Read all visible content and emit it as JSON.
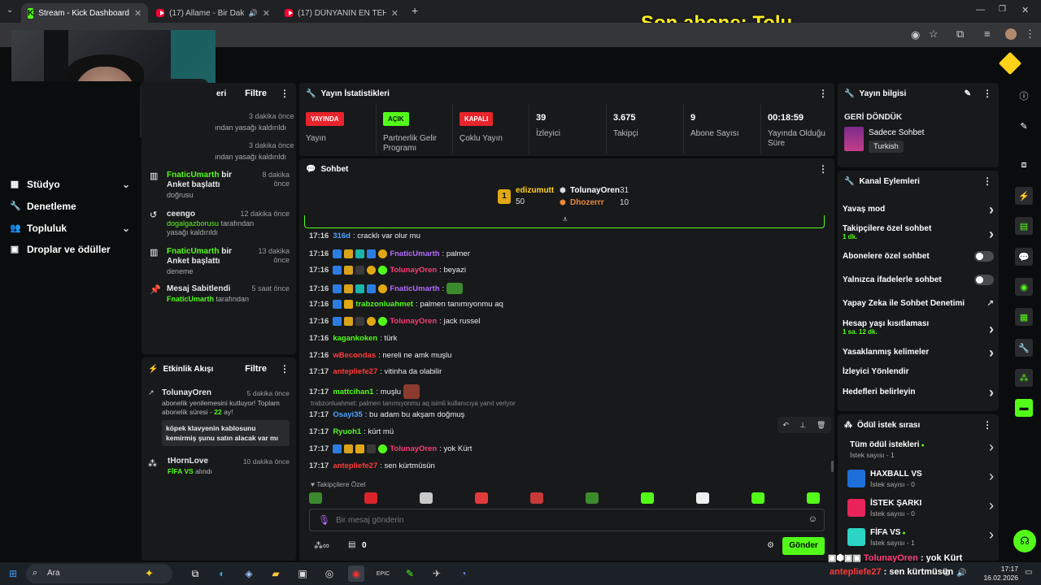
{
  "browser": {
    "tabs": [
      {
        "title": "Stream - Kick Dashboard",
        "active": true
      },
      {
        "title": "(17) Allame - Bir Dakika (Offi",
        "active": false
      },
      {
        "title": "(17) DÜNYANIN EN TEHLİKELİ T",
        "active": false
      }
    ],
    "new_tab": "+"
  },
  "overlay": {
    "subscriber_alert": "Son abone: Tolu"
  },
  "nav": {
    "items": [
      {
        "label": "Stüdyo",
        "icon": "studio-icon",
        "expandable": true
      },
      {
        "label": "Denetleme",
        "icon": "wrench-icon",
        "expandable": false
      },
      {
        "label": "Topluluk",
        "icon": "people-icon",
        "expandable": true
      },
      {
        "label": "Droplar ve ödüller",
        "icon": "gift-icon",
        "expandable": false
      }
    ]
  },
  "modlog": {
    "title_partial": "eri",
    "filter": "Filtre",
    "entries": [
      {
        "line1": "",
        "line2": "ından yasağı kaldırıldı",
        "when": "3 dakika önce"
      },
      {
        "line1": "",
        "line2": "ından yasağı kaldırıldı",
        "when": "3 dakika önce"
      },
      {
        "user": "FnaticUmarth",
        "action": " bir Anket başlattı",
        "detail": "doğrusu",
        "when": "8 dakika önce"
      },
      {
        "user": "ceengo",
        "detail_user": "dogalgazborusu",
        "detail": " tarafından yasağı kaldırıldı",
        "when": "12 dakika önce"
      },
      {
        "user": "FnaticUmarth",
        "action": " bir Anket başlattı",
        "detail": "deneme",
        "when": "13 dakika önce"
      },
      {
        "user": "Mesaj Sabitlendi",
        "detail_user": "FnaticUmarth",
        "detail": " tarafından",
        "when": "5 saat önce"
      }
    ]
  },
  "activity": {
    "title": "Etkinlik Akışı",
    "filter": "Filtre",
    "items": [
      {
        "user": "TolunayOren",
        "when": "5 dakika önce",
        "text": "abonelik yenilemesini kutluyor! Toplam abonelik süresi - ",
        "months": "22",
        "months_suffix": " ay!",
        "message": "köpek klavyenin kablosunu kemirmiş şunu satın alacak var mı"
      },
      {
        "user": "tHornLove",
        "when": "10 dakika önce",
        "reward": "FİFA VS",
        "reward_suffix": " alındı"
      }
    ]
  },
  "stats": {
    "title": "Yayın İstatistikleri",
    "cells": [
      {
        "badge": "YAYINDA",
        "badge_color": "#e8242c",
        "label": "Yayın"
      },
      {
        "badge": "AÇIK",
        "badge_color": "#53fc18",
        "label": "Partnerlik Gelir Programı"
      },
      {
        "badge": "KAPALI",
        "badge_color": "#e8242c",
        "label": "Çoklu Yayın"
      },
      {
        "value": "39",
        "label": "İzleyici"
      },
      {
        "value": "3.675",
        "label": "Takipçi"
      },
      {
        "value": "9",
        "label": "Abone Sayısı"
      },
      {
        "value": "00:18:59",
        "label": "Yayında Olduğu Süre"
      }
    ]
  },
  "chat": {
    "title": "Sohbet",
    "leaderboard": [
      {
        "name": "edizumutt",
        "count": "50",
        "rank": "1"
      },
      {
        "name": "TolunayOren",
        "count": "31"
      },
      {
        "name": "Dhozerrr",
        "count": "10"
      }
    ],
    "messages": [
      {
        "time": "17:16",
        "user": "316d",
        "color": "#4ea3ff",
        "text": ": cracklı var olur mu",
        "badges": []
      },
      {
        "time": "17:16",
        "user": "FnaticUmarth",
        "color": "#b46bff",
        "text": ": palmer",
        "badges": [
          "#2d7de0",
          "#d8a21a",
          "#19b5a8",
          "#2d7de0",
          "#e0a812"
        ]
      },
      {
        "time": "17:16",
        "user": "TolunayOren",
        "color": "#ff3d7a",
        "text": ": beyazi",
        "badges": [
          "#2d7de0",
          "#d8a21a",
          "#3a3a3a",
          "#e0a812",
          "#53fc18"
        ]
      },
      {
        "time": "17:16",
        "user": "FnaticUmarth",
        "color": "#b46bff",
        "text": ":",
        "emote": "#3c8a2e",
        "badges": [
          "#2d7de0",
          "#d8a21a",
          "#19b5a8",
          "#2d7de0",
          "#e0a812"
        ]
      },
      {
        "time": "17:16",
        "user": "trabzonluahmet",
        "color": "#53fc18",
        "text": ": palmerı tanımıyonmu aq",
        "badges": [
          "#2d7de0",
          "#e0a812"
        ]
      },
      {
        "time": "17:16",
        "user": "TolunayOren",
        "color": "#ff3d7a",
        "text": ": jack russel",
        "badges": [
          "#2d7de0",
          "#d8a21a",
          "#3a3a3a",
          "#e0a812",
          "#53fc18"
        ]
      },
      {
        "time": "17:16",
        "user": "kagankoken",
        "color": "#53fc18",
        "text": ": türk",
        "badges": []
      },
      {
        "time": "17:16",
        "user": "wBecondas",
        "color": "#ff3b3b",
        "text": ": nereli ne amk muşlu",
        "badges": []
      },
      {
        "time": "17:17",
        "user": "antepliefe27",
        "color": "#ff3b3b",
        "text": ": vitinha da olabilir",
        "badges": []
      },
      {
        "time": "17:17",
        "user": "mattcihan1",
        "color": "#53fc18",
        "text": ": muşlu",
        "emote": "#8a3a2e",
        "badges": []
      },
      {
        "time": "17:17",
        "user": "Osayi35",
        "color": "#4ea3ff",
        "text": ": bu adam bu akşam doğmuş",
        "badges": [],
        "reply": "trabzonluahmet: palmerı tanımıyonmu aq isimli kullanıcıya yanıt veriyor"
      },
      {
        "time": "17:17",
        "user": "Ryuoh1",
        "color": "#53fc18",
        "text": ": kürt mü",
        "badges": []
      },
      {
        "time": "17:17",
        "user": "TolunayOren",
        "color": "#ff3d7a",
        "text": ": yok Kürt",
        "badges": [
          "#2d7de0",
          "#d8a21a",
          "#e0a812",
          "#3a3a3a",
          "#53fc18"
        ]
      },
      {
        "time": "17:17",
        "user": "antepliefe27",
        "color": "#ff3b3b",
        "text": ": sen kürtmüsün",
        "badges": []
      }
    ],
    "followers_only_label": "Takipçilere Özel",
    "input_placeholder": "Bir mesaj gönderin",
    "points": "0",
    "send": "Gönder"
  },
  "stream_info": {
    "title": "Yayın bilgisi",
    "stream_title": "GERİ DÖNDÜK",
    "category": "Sadece Sohbet",
    "language": "Turkish"
  },
  "channel_actions": {
    "title": "Kanal Eylemleri",
    "items": [
      {
        "label": "Yavaş mod",
        "sub": "",
        "control": "chevron"
      },
      {
        "label": "Takipçilere özel sohbet",
        "sub": "1 dk.",
        "control": "chevron"
      },
      {
        "label": "Abonelere özel sohbet",
        "sub": "",
        "control": "toggle"
      },
      {
        "label": "Yalnızca ifadelerle sohbet",
        "sub": "",
        "control": "toggle"
      },
      {
        "label": "Yapay Zeka ile Sohbet Denetimi",
        "sub": "",
        "control": "external"
      },
      {
        "label": "Hesap yaşı kısıtlaması",
        "sub": "1 sa. 12 dk.",
        "control": "chevron"
      },
      {
        "label": "Yasaklanmış kelimeler",
        "sub": "",
        "control": "chevron"
      },
      {
        "label": "İzleyici Yönlendir",
        "sub": "",
        "control": "none"
      },
      {
        "label": "Hedefleri belirleyin",
        "sub": "",
        "control": "chevron"
      }
    ]
  },
  "rewards": {
    "title": "Ödül istek sırası",
    "items": [
      {
        "name": "Tüm ödül istekleri",
        "count": "İstek sayısı - 1",
        "color": "",
        "dot": true
      },
      {
        "name": "HAXBALL VS",
        "count": "İstek sayısı - 0",
        "color": "#1e6fd9",
        "dot": false
      },
      {
        "name": "İSTEK ŞARKI",
        "count": "İstek sayısı - 0",
        "color": "#e8245a",
        "dot": false
      },
      {
        "name": "FİFA VS",
        "count": "İstek sayısı - 1",
        "color": "#2bd4c4",
        "dot": true
      }
    ]
  },
  "overlay_chat": [
    {
      "user": "TolunayOren",
      "text": " : yok Kürt"
    },
    {
      "user": "antepliefe27",
      "text": " : sen kürtmüsün"
    }
  ],
  "taskbar": {
    "search": "Ara",
    "time": "17:17",
    "date": "16.02.2026"
  },
  "colors": {
    "accent": "#53fc18",
    "panel": "#18191b",
    "bg": "#0b0c0d"
  }
}
